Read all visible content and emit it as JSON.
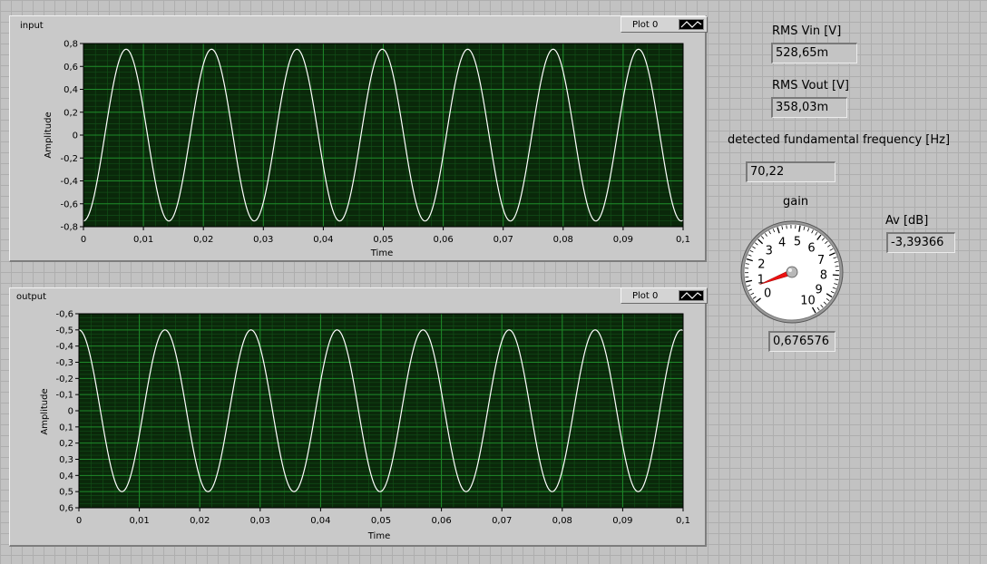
{
  "input_graph": {
    "label": "input",
    "legend_label": "Plot 0",
    "y_axis_label": "Amplitude",
    "x_axis_label": "Time",
    "y_ticks": [
      "0,8",
      "0,6",
      "0,4",
      "0,2",
      "0",
      "-0,2",
      "-0,4",
      "-0,6",
      "-0,8"
    ],
    "x_ticks": [
      "0",
      "0,01",
      "0,02",
      "0,03",
      "0,04",
      "0,05",
      "0,06",
      "0,07",
      "0,08",
      "0,09",
      "0,1"
    ]
  },
  "output_graph": {
    "label": "output",
    "legend_label": "Plot 0",
    "y_axis_label": "Amplitude",
    "x_axis_label": "Time",
    "y_ticks": [
      "-0,6",
      "-0,5",
      "-0,4",
      "-0,3",
      "-0,2",
      "-0,1",
      "0",
      "0,1",
      "0,2",
      "0,3",
      "0,4",
      "0,5",
      "0,6"
    ],
    "x_ticks": [
      "0",
      "0,01",
      "0,02",
      "0,03",
      "0,04",
      "0,05",
      "0,06",
      "0,07",
      "0,08",
      "0,09",
      "0,1"
    ]
  },
  "indicators": {
    "rms_vin": {
      "label": "RMS Vin [V]",
      "value": "528,65m"
    },
    "rms_vout": {
      "label": "RMS Vout [V]",
      "value": "358,03m"
    },
    "fundamental": {
      "label": "detected fundamental frequency [Hz]",
      "value": "70,22"
    },
    "gain": {
      "label": "gain",
      "value": "0,676576",
      "dial_ticks": [
        "0",
        "1",
        "2",
        "3",
        "4",
        "5",
        "6",
        "7",
        "8",
        "9",
        "10"
      ]
    },
    "av": {
      "label": "Av [dB]",
      "value": "-3,39366"
    }
  },
  "chart_data": [
    {
      "type": "line",
      "title": "input",
      "xlabel": "Time",
      "ylabel": "Amplitude",
      "xlim": [
        0,
        0.1
      ],
      "ylim": [
        -0.8,
        0.8
      ],
      "series": [
        {
          "name": "Plot 0",
          "function": "sine",
          "amplitude": 0.75,
          "frequency_hz": 70.22,
          "phase_deg": -90,
          "color": "#ffffff"
        }
      ]
    },
    {
      "type": "line",
      "title": "output",
      "xlabel": "Time",
      "ylabel": "Amplitude",
      "xlim": [
        0,
        0.1
      ],
      "ylim": [
        -0.6,
        0.6
      ],
      "y_axis_inverted": true,
      "series": [
        {
          "name": "Plot 0",
          "function": "sine",
          "amplitude": 0.5,
          "frequency_hz": 70.22,
          "phase_deg": -90,
          "color": "#ffffff"
        }
      ]
    }
  ],
  "colors": {
    "plot_background": "#0a280a",
    "grid_major": "#1f8a2a",
    "grid_minor": "#124d17",
    "trace": "#ffffff",
    "needle": "#ee1111"
  }
}
